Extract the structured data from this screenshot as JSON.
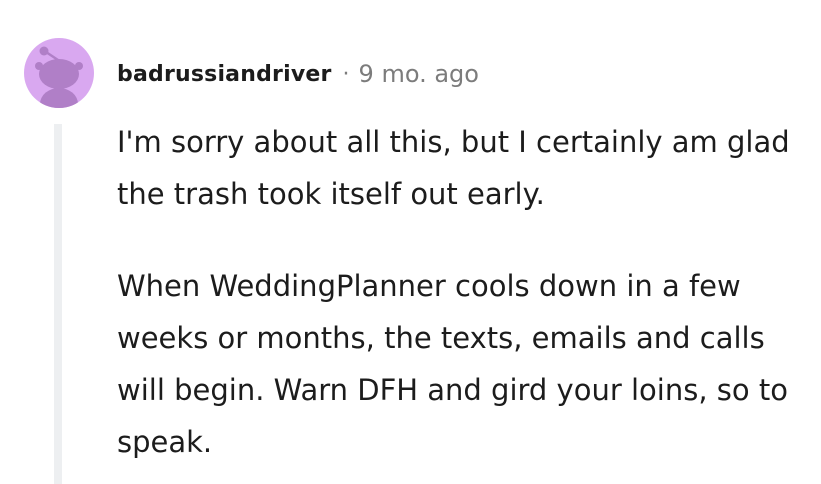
{
  "comment": {
    "author": "badrussiandriver",
    "separator": "·",
    "timestamp": "9 mo. ago",
    "avatar_icon": "snoo-avatar-icon",
    "paragraphs": [
      "I'm sorry about all this, but I certainly am glad the trash took itself out early.",
      "When WeddingPlanner cools down in a few weeks or months, the texts, emails and calls will begin. Warn DFH and gird your loins, so to speak."
    ]
  },
  "colors": {
    "avatar_bg": "#d9a8f0",
    "avatar_figure": "#b07fc7",
    "text": "#1c1c1c",
    "muted": "#7c7c7c",
    "thread_line": "#edeff1"
  }
}
